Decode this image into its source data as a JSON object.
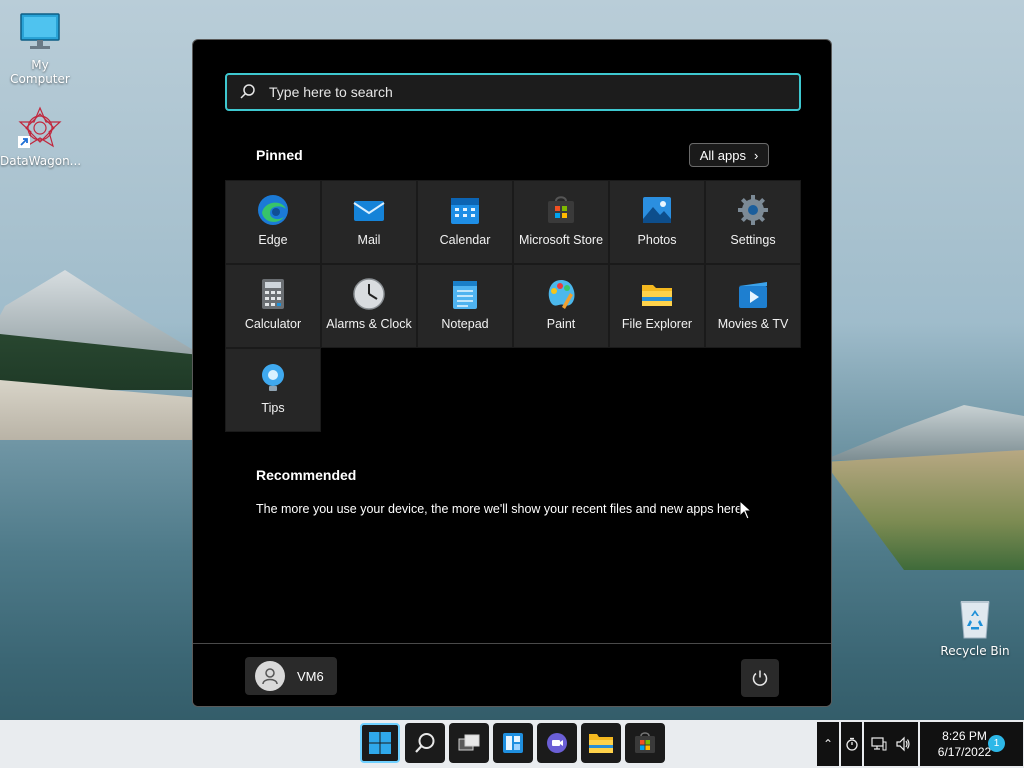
{
  "desktop": {
    "icons": [
      {
        "label": "My Computer"
      },
      {
        "label": "DataWagon..."
      },
      {
        "label": "Recycle Bin"
      }
    ]
  },
  "start_menu": {
    "search": {
      "placeholder": "Type here to search"
    },
    "pinned": {
      "title": "Pinned",
      "all_apps_label": "All apps",
      "apps": [
        {
          "label": "Edge",
          "icon": "edge-icon"
        },
        {
          "label": "Mail",
          "icon": "mail-icon"
        },
        {
          "label": "Calendar",
          "icon": "calendar-icon"
        },
        {
          "label": "Microsoft Store",
          "icon": "store-icon"
        },
        {
          "label": "Photos",
          "icon": "photos-icon"
        },
        {
          "label": "Settings",
          "icon": "gear-icon"
        },
        {
          "label": "Calculator",
          "icon": "calculator-icon"
        },
        {
          "label": "Alarms & Clock",
          "icon": "clock-icon"
        },
        {
          "label": "Notepad",
          "icon": "notepad-icon"
        },
        {
          "label": "Paint",
          "icon": "paint-icon"
        },
        {
          "label": "File Explorer",
          "icon": "folder-icon"
        },
        {
          "label": "Movies & TV",
          "icon": "movies-icon"
        },
        {
          "label": "Tips",
          "icon": "lightbulb-icon"
        }
      ]
    },
    "recommended": {
      "title": "Recommended",
      "empty_text": "The more you use your device, the more we'll show your recent files and new apps here."
    },
    "user": {
      "name": "VM6"
    }
  },
  "taskbar": {
    "clock_time": "8:26 PM",
    "clock_date": "6/17/2022",
    "notification_count": "1"
  },
  "colors": {
    "accent": "#3ec8d0",
    "start_bg": "#000000",
    "tile_bg": "#262626"
  }
}
